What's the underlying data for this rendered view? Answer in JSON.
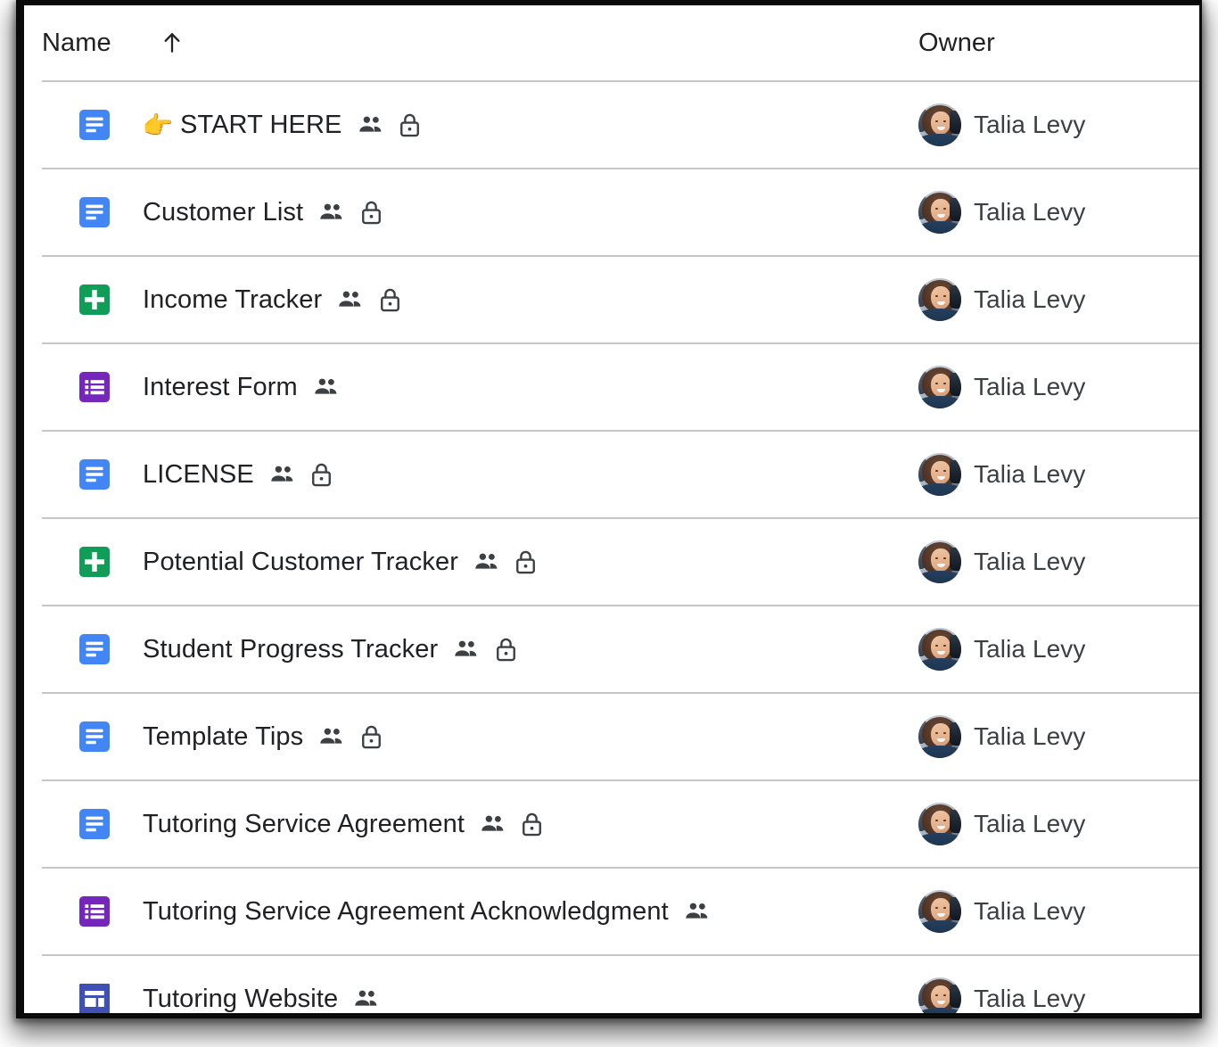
{
  "table": {
    "columns": {
      "name": "Name",
      "owner": "Owner"
    },
    "sort": {
      "column": "Name",
      "direction": "ascending",
      "icon": "arrow-up-icon"
    },
    "colors": {
      "docs": "#4285f4",
      "sheets": "#0f9d58",
      "forms": "#7627bb",
      "sites": "#3f51b5",
      "divider": "#c4c7c5",
      "text": "#202124",
      "secondary_text": "#3c4043"
    },
    "rows": [
      {
        "name": "👉 START HERE",
        "title": "START HERE",
        "emoji": "👉",
        "file_type": "document",
        "icon": "google-docs-icon",
        "shared": true,
        "shared_icon": "people-shared-icon",
        "locked": true,
        "lock_icon": "lock-icon",
        "owner": "Talia Levy"
      },
      {
        "name": "Customer List",
        "title": "Customer List",
        "emoji": "",
        "file_type": "document",
        "icon": "google-docs-icon",
        "shared": true,
        "shared_icon": "people-shared-icon",
        "locked": true,
        "lock_icon": "lock-icon",
        "owner": "Talia Levy"
      },
      {
        "name": "Income Tracker",
        "title": "Income Tracker",
        "emoji": "",
        "file_type": "spreadsheet",
        "icon": "google-sheets-icon",
        "shared": true,
        "shared_icon": "people-shared-icon",
        "locked": true,
        "lock_icon": "lock-icon",
        "owner": "Talia Levy"
      },
      {
        "name": "Interest Form",
        "title": "Interest Form",
        "emoji": "",
        "file_type": "form",
        "icon": "google-forms-icon",
        "shared": true,
        "shared_icon": "people-shared-icon",
        "locked": false,
        "lock_icon": "",
        "owner": "Talia Levy"
      },
      {
        "name": "LICENSE",
        "title": "LICENSE",
        "emoji": "",
        "file_type": "document",
        "icon": "google-docs-icon",
        "shared": true,
        "shared_icon": "people-shared-icon",
        "locked": true,
        "lock_icon": "lock-icon",
        "owner": "Talia Levy"
      },
      {
        "name": "Potential Customer Tracker",
        "title": "Potential Customer Tracker",
        "emoji": "",
        "file_type": "spreadsheet",
        "icon": "google-sheets-icon",
        "shared": true,
        "shared_icon": "people-shared-icon",
        "locked": true,
        "lock_icon": "lock-icon",
        "owner": "Talia Levy"
      },
      {
        "name": "Student Progress Tracker",
        "title": "Student Progress Tracker",
        "emoji": "",
        "file_type": "document",
        "icon": "google-docs-icon",
        "shared": true,
        "shared_icon": "people-shared-icon",
        "locked": true,
        "lock_icon": "lock-icon",
        "owner": "Talia Levy"
      },
      {
        "name": "Template Tips",
        "title": "Template Tips",
        "emoji": "",
        "file_type": "document",
        "icon": "google-docs-icon",
        "shared": true,
        "shared_icon": "people-shared-icon",
        "locked": true,
        "lock_icon": "lock-icon",
        "owner": "Talia Levy"
      },
      {
        "name": "Tutoring Service Agreement",
        "title": "Tutoring Service Agreement",
        "emoji": "",
        "file_type": "document",
        "icon": "google-docs-icon",
        "shared": true,
        "shared_icon": "people-shared-icon",
        "locked": true,
        "lock_icon": "lock-icon",
        "owner": "Talia Levy"
      },
      {
        "name": "Tutoring Service Agreement Acknowledgment",
        "title": "Tutoring Service Agreement Acknowledgment",
        "emoji": "",
        "file_type": "form",
        "icon": "google-forms-icon",
        "shared": true,
        "shared_icon": "people-shared-icon",
        "locked": false,
        "lock_icon": "",
        "owner": "Talia Levy"
      },
      {
        "name": "Tutoring Website",
        "title": "Tutoring Website",
        "emoji": "",
        "file_type": "site",
        "icon": "google-sites-icon",
        "shared": true,
        "shared_icon": "people-shared-icon",
        "locked": false,
        "lock_icon": "",
        "owner": "Talia Levy"
      }
    ]
  }
}
